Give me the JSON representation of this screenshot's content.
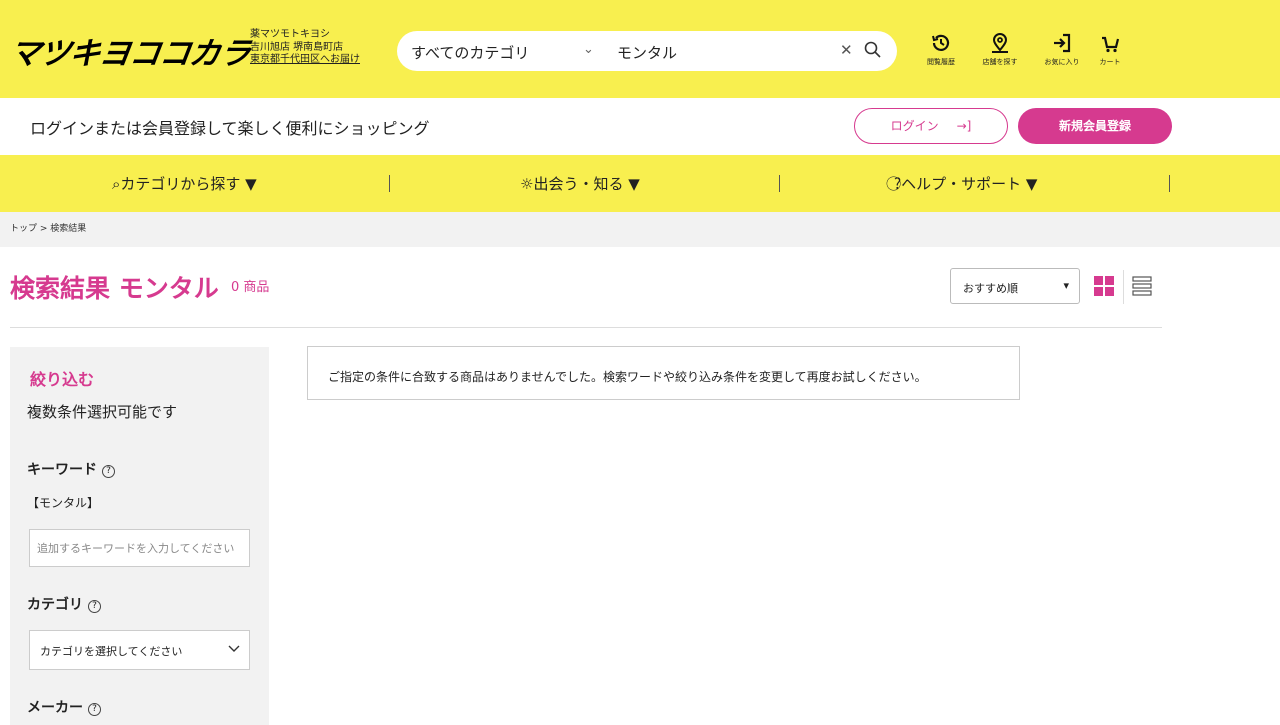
{
  "header": {
    "logo": "マツキヨココカラ",
    "store_line1": "薬マツモトキヨシ",
    "store_line2": "吉川旭店 堺南島町店",
    "store_line3": "東京都千代田区へお届け",
    "search": {
      "category": "すべてのカテゴリ",
      "query": "モンタル"
    },
    "icons": [
      {
        "label": "閲覧履歴",
        "icon": "history-icon"
      },
      {
        "label": "店舗を探す",
        "icon": "store-pin-icon"
      },
      {
        "label": "お気に入り",
        "icon": "favorite-login-icon"
      },
      {
        "label": "カート",
        "icon": "cart-icon"
      }
    ]
  },
  "loginbar": {
    "message": "ログインまたは会員登録して楽しく便利にショッピング",
    "login_label": "ログイン",
    "register_label": "新規会員登録"
  },
  "nav": {
    "items": [
      "カテゴリから探す ▼",
      "出会う・知る ▼",
      "ヘルプ・サポート ▼"
    ]
  },
  "breadcrumb": {
    "home": "トップ",
    "current": "検索結果"
  },
  "results": {
    "title": "検索結果 モンタル",
    "count": "0 商品",
    "sort": "おすすめ順",
    "notice": "ご指定の条件に合致する商品はありませんでした。検索ワードや絞り込み条件を変更して再度お試しください。"
  },
  "filter": {
    "title": "絞り込む",
    "subtitle": "複数条件選択可能です",
    "keyword_label": "キーワード",
    "keyword_value": "【モンタル】",
    "keyword_placeholder": "追加するキーワードを入力してください",
    "category_label": "カテゴリ",
    "category_select": "カテゴリを選択してください",
    "maker_label": "メーカー",
    "help_glyph": "?"
  },
  "colors": {
    "brand_yellow": "#f8ef4f",
    "brand_pink": "#d63a8f"
  }
}
